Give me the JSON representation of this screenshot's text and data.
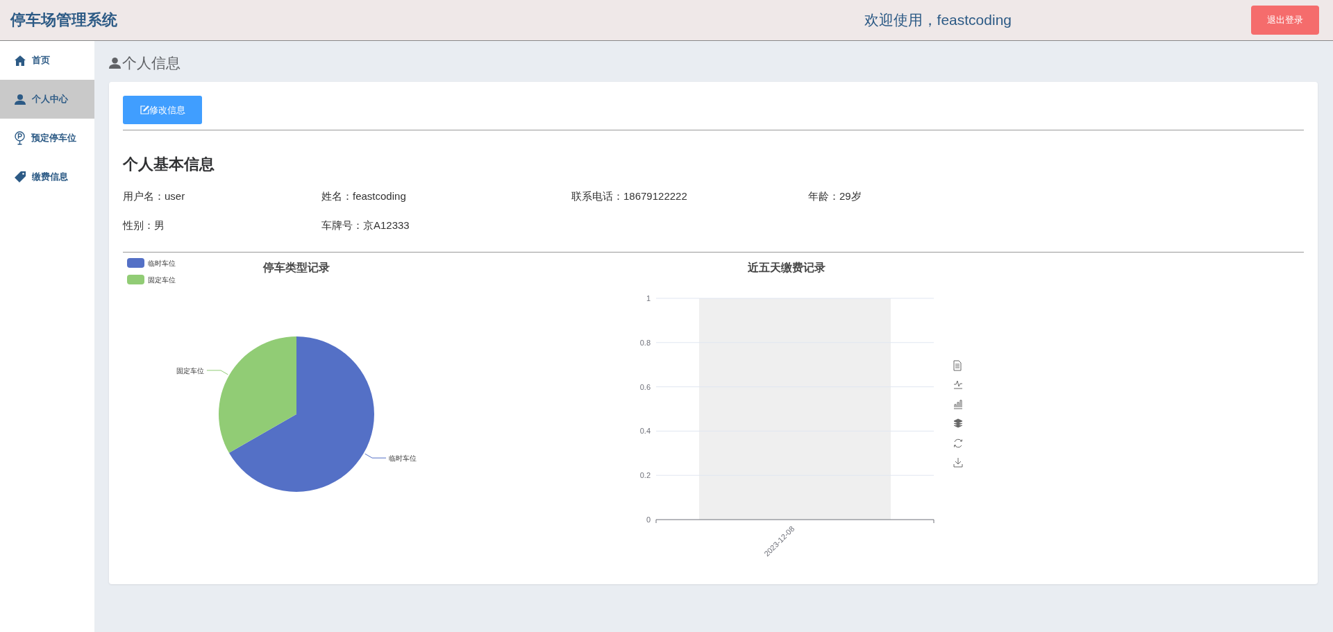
{
  "header": {
    "title": "停车场管理系统",
    "welcome": "欢迎使用，feastcoding",
    "logout_button": "退出登录"
  },
  "sidebar": {
    "items": [
      {
        "label": "首页",
        "selected": false
      },
      {
        "label": "个人中心",
        "selected": true
      },
      {
        "label": "预定停车位",
        "selected": false
      },
      {
        "label": "缴费信息",
        "selected": false
      }
    ]
  },
  "page_title": "个人信息",
  "edit_button": "修改信息",
  "section_title": "个人基本信息",
  "fields": [
    [
      "用户名：user",
      "姓名：feastcoding",
      "联系电话：18679122222",
      "年龄：29岁"
    ],
    [
      "性别：男",
      "车牌号：京A12333"
    ]
  ],
  "pie_chart": {
    "chart_data": {
      "type": "pie",
      "title": "停车类型记录",
      "categories": [
        "临时车位",
        "固定车位"
      ],
      "values": [
        66.7,
        33.3
      ],
      "colors": [
        "#5470c6",
        "#91cc75"
      ],
      "legend": "top-left"
    }
  },
  "bar_chart": {
    "chart_data": {
      "type": "bar",
      "title": "近五天缴费记录",
      "categories": [
        "2023-12-08"
      ],
      "values": [
        0
      ],
      "ylim": [
        0,
        1
      ],
      "yticks": [
        0,
        0.2,
        0.4,
        0.6,
        0.8,
        1
      ],
      "grid": true
    }
  }
}
